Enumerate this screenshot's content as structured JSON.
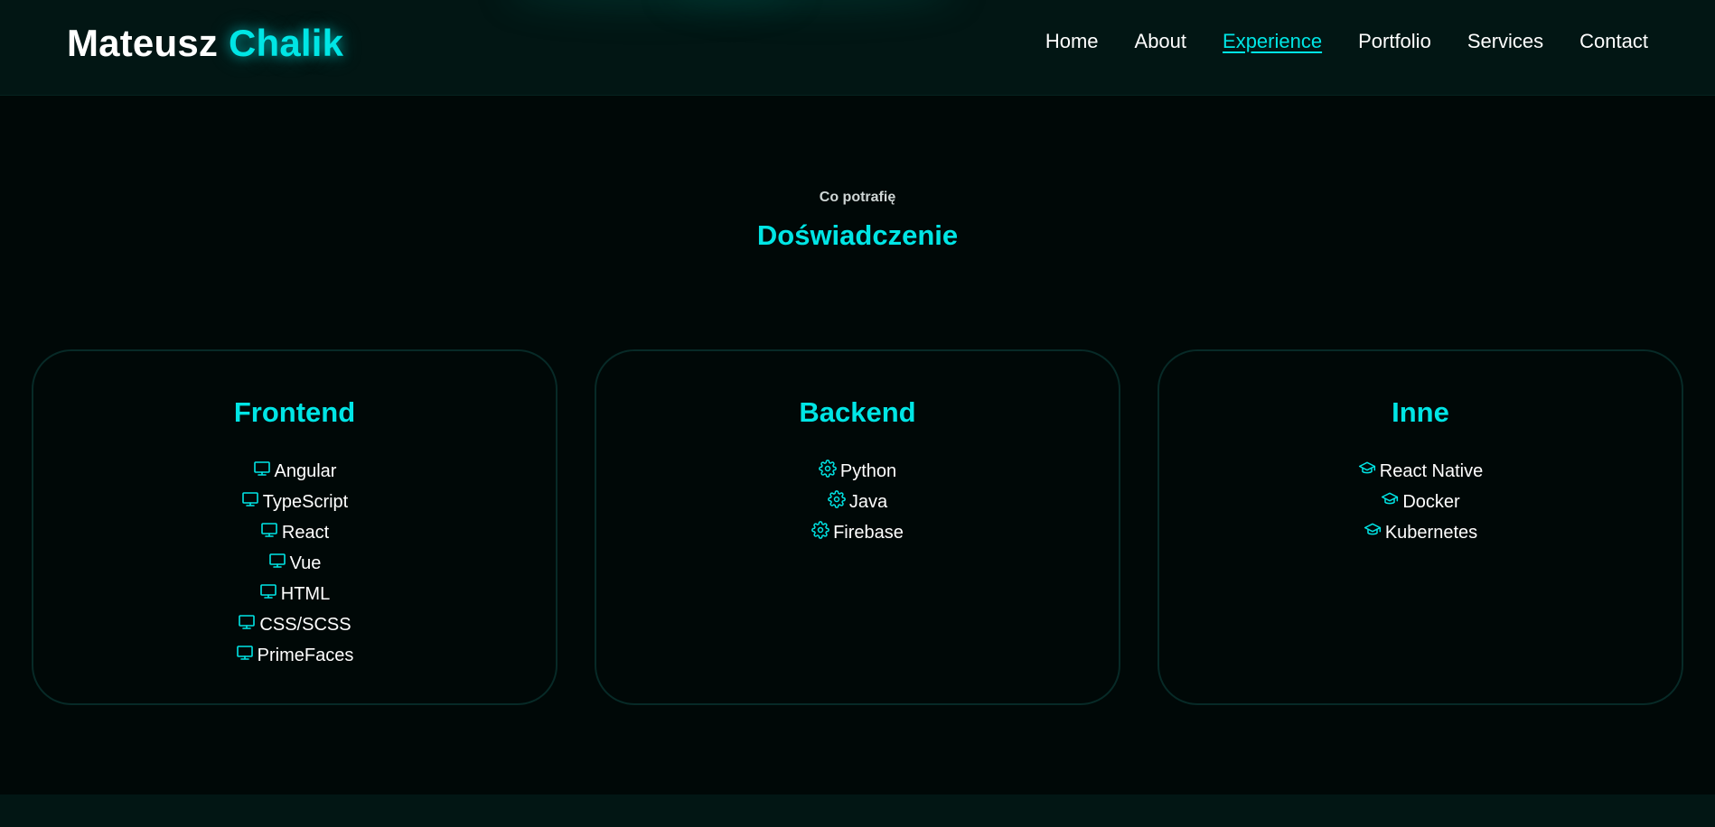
{
  "brand": {
    "first": "Mateusz",
    "last": "Chalik"
  },
  "nav": [
    {
      "label": "Home",
      "active": false
    },
    {
      "label": "About",
      "active": false
    },
    {
      "label": "Experience",
      "active": true
    },
    {
      "label": "Portfolio",
      "active": false
    },
    {
      "label": "Services",
      "active": false
    },
    {
      "label": "Contact",
      "active": false
    }
  ],
  "section": {
    "subtitle": "Co potrafię",
    "title": "Doświadczenie"
  },
  "cards": [
    {
      "title": "Frontend",
      "icon": "monitor-icon",
      "items": [
        "Angular",
        "TypeScript",
        "React",
        "Vue",
        "HTML",
        "CSS/SCSS",
        "PrimeFaces"
      ]
    },
    {
      "title": "Backend",
      "icon": "gear-icon",
      "items": [
        "Python",
        "Java",
        "Firebase"
      ]
    },
    {
      "title": "Inne",
      "icon": "graduation-cap-icon",
      "items": [
        "React Native",
        "Docker",
        "Kubernetes"
      ]
    }
  ],
  "colors": {
    "accent": "#00e5e5",
    "background": "#000807",
    "header": "#021614",
    "card_border": "#072a27",
    "text": "#ffffff"
  }
}
